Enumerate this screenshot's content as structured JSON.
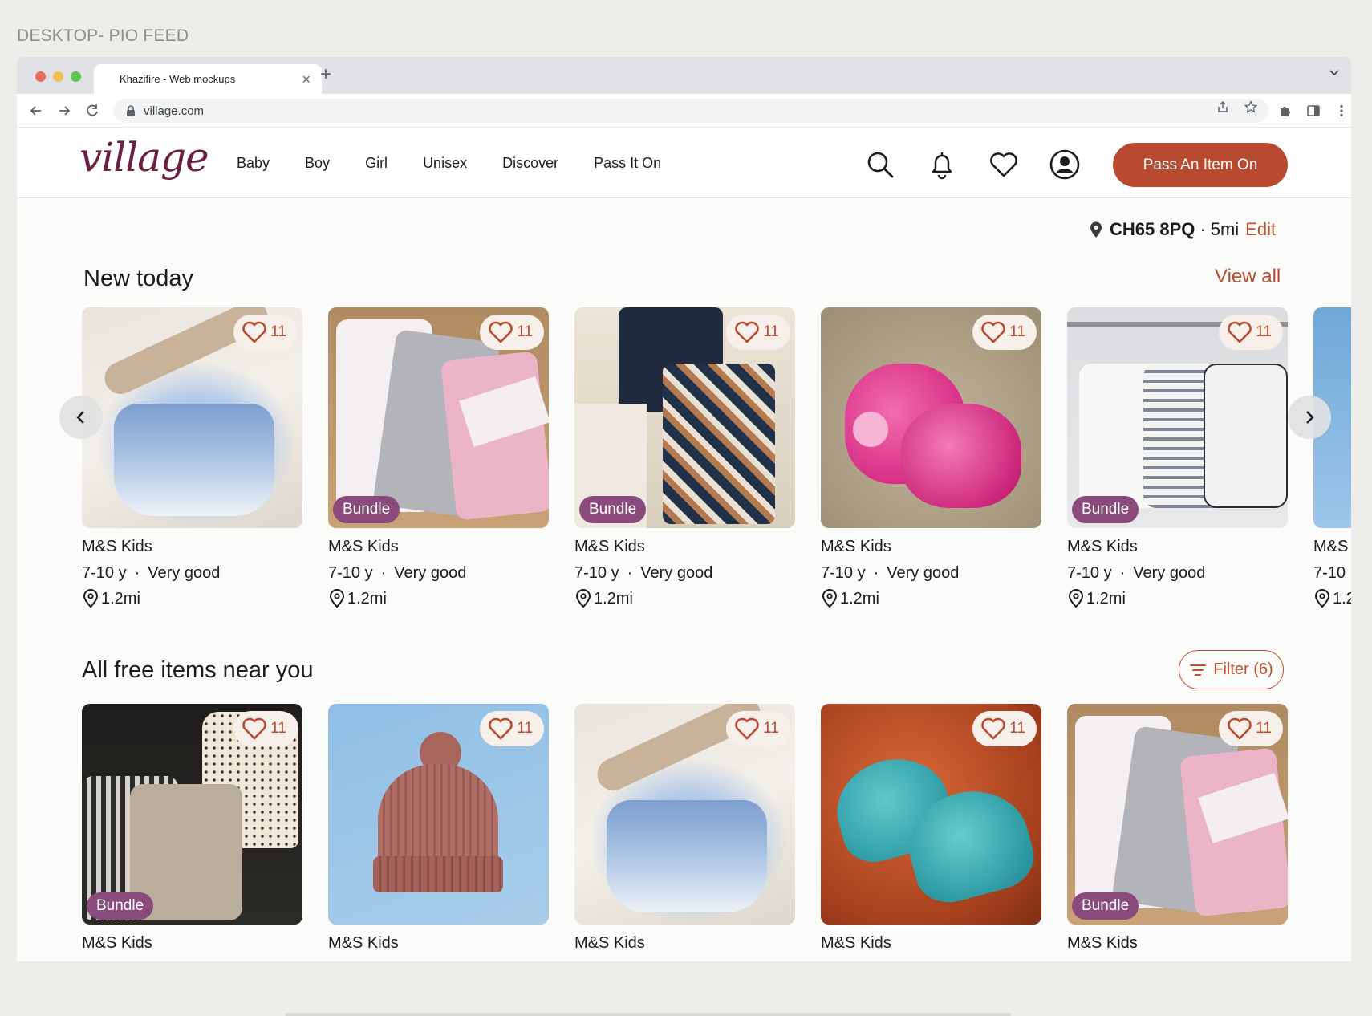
{
  "frame_label": "DESKTOP- PIO FEED",
  "browser": {
    "tab_title": "Khazifire - Web mockups",
    "url": "village.com"
  },
  "header": {
    "logo": "village",
    "nav": [
      "Baby",
      "Boy",
      "Girl",
      "Unisex",
      "Discover",
      "Pass It On"
    ],
    "cta_label": "Pass An Item On"
  },
  "location": {
    "postcode": "CH65 8PQ",
    "separator": "·",
    "radius": "5mi",
    "edit_label": "Edit"
  },
  "new_today": {
    "title": "New today",
    "view_all_label": "View all",
    "items": [
      {
        "brand": "M&S Kids",
        "age": "7-10 y",
        "condition": "Very good",
        "distance": "1.2mi",
        "likes": "11",
        "bundle": ""
      },
      {
        "brand": "M&S Kids",
        "age": "7-10 y",
        "condition": "Very good",
        "distance": "1.2mi",
        "likes": "11",
        "bundle": "Bundle"
      },
      {
        "brand": "M&S Kids",
        "age": "7-10 y",
        "condition": "Very good",
        "distance": "1.2mi",
        "likes": "11",
        "bundle": "Bundle"
      },
      {
        "brand": "M&S Kids",
        "age": "7-10 y",
        "condition": "Very good",
        "distance": "1.2mi",
        "likes": "11",
        "bundle": ""
      },
      {
        "brand": "M&S Kids",
        "age": "7-10 y",
        "condition": "Very good",
        "distance": "1.2mi",
        "likes": "11",
        "bundle": "Bundle"
      },
      {
        "brand": "M&S",
        "age": "7-10",
        "condition": "",
        "distance": "1.2",
        "likes": "",
        "bundle": ""
      }
    ]
  },
  "all_free": {
    "title": "All free items near you",
    "filter_label": "Filter (6)",
    "items": [
      {
        "brand": "M&S Kids",
        "likes": "11",
        "bundle": "Bundle"
      },
      {
        "brand": "M&S Kids",
        "likes": "11",
        "bundle": ""
      },
      {
        "brand": "M&S Kids",
        "likes": "11",
        "bundle": ""
      },
      {
        "brand": "M&S Kids",
        "likes": "11",
        "bundle": ""
      },
      {
        "brand": "M&S Kids",
        "likes": "11",
        "bundle": "Bundle"
      }
    ]
  },
  "colors": {
    "accent": "#b84a2f",
    "brand": "#6b2043",
    "bundle_badge": "#8a4a7c"
  }
}
